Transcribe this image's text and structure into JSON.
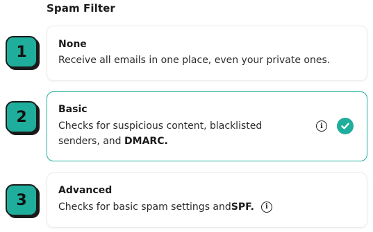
{
  "section": {
    "title": "Spam Filter"
  },
  "options": [
    {
      "number": "1",
      "title": "None",
      "description": "Receive all emails in one place, even your private ones.",
      "selected": false
    },
    {
      "number": "2",
      "title": "Basic",
      "description_prefix": "Checks for suspicious content, blacklisted senders, and ",
      "description_emphasis": "DMARC.",
      "selected": true
    },
    {
      "number": "3",
      "title": "Advanced",
      "description_prefix": "Checks for basic spam settings and ",
      "description_emphasis": "SPF.",
      "selected": false
    }
  ],
  "icons": {
    "info": "info-icon",
    "selected": "check-circle-icon"
  },
  "colors": {
    "accent": "#1fae9b",
    "badge_border": "#1a1a1a",
    "text": "#1b1b1b",
    "card_border": "#ececec"
  }
}
